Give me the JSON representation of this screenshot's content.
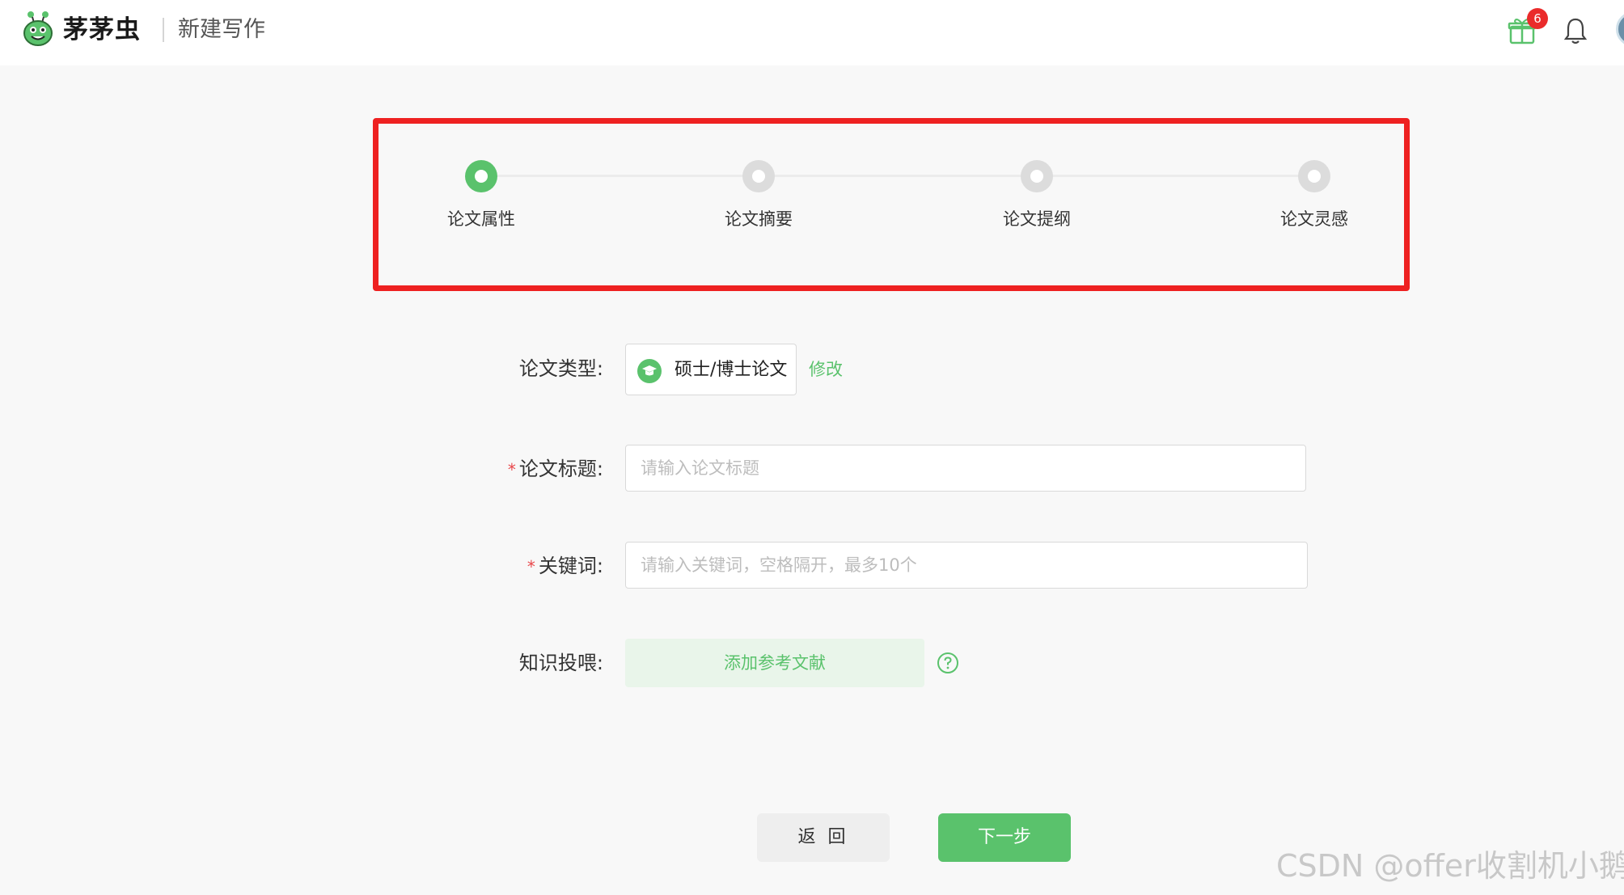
{
  "header": {
    "logo_text": "茅茅虫",
    "page_title": "新建写作",
    "gift_badge_count": "6",
    "icons": [
      "mascot-logo-icon",
      "gift-icon",
      "bell-icon",
      "avatar"
    ]
  },
  "steps": [
    {
      "label": "论文属性",
      "state": "active"
    },
    {
      "label": "论文摘要",
      "state": "pending"
    },
    {
      "label": "论文提纲",
      "state": "pending"
    },
    {
      "label": "论文灵感",
      "state": "pending"
    }
  ],
  "form": {
    "type_label": "论文类型:",
    "type_value": "硕士/博士论文",
    "modify_link": "修改",
    "title_required": "*",
    "title_label": "论文标题:",
    "title_placeholder": "请输入论文标题",
    "keywords_required": "*",
    "keywords_label": "关键词:",
    "keywords_placeholder": "请输入关键词，空格隔开，最多10个",
    "knowledge_label": "知识投喂:",
    "add_reference_button": "添加参考文献"
  },
  "footer": {
    "back_button": "返 回",
    "next_button": "下一步"
  },
  "watermark": "CSDN @offer收割机小鹅",
  "colors": {
    "accent": "#5ac26c",
    "highlight_border": "#ee2121",
    "badge": "#ea2b2b"
  }
}
